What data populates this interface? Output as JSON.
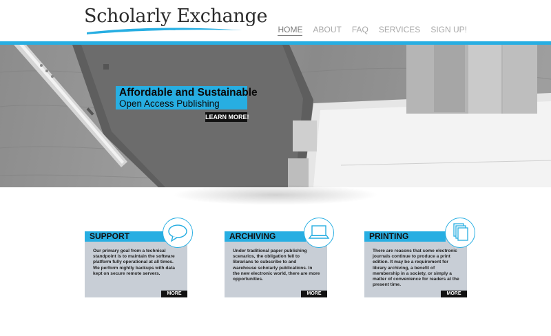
{
  "brand": {
    "name": "Scholarly Exchange",
    "accent": "#27aee2"
  },
  "nav": {
    "items": [
      {
        "label": "HOME",
        "active": true
      },
      {
        "label": "ABOUT",
        "active": false
      },
      {
        "label": "FAQ",
        "active": false
      },
      {
        "label": "SERVICES",
        "active": false
      },
      {
        "label": "SIGN UP!",
        "active": false
      }
    ]
  },
  "hero": {
    "title": "Affordable and Sustainable",
    "subtitle": "Open Access Publishing",
    "cta_label": "LEARN MORE!"
  },
  "cards": [
    {
      "title": "SUPPORT",
      "icon": "speech-bubble-icon",
      "text": "Our primary goal from a technical standpoint is to maintain the software platform fully operational at all times. We perform nightly backups with data kept on secure remote servers.",
      "more_label": "MORE"
    },
    {
      "title": "ARCHIVING",
      "icon": "laptop-icon",
      "text": "Under traditional paper publishing scenarios, the obligation fell to librarians to subscribe to and warehouse scholarly publications. In the new electronic world, there are more opportunities.",
      "more_label": "MORE"
    },
    {
      "title": "PRINTING",
      "icon": "documents-icon",
      "text": "There are reasons that some electronic journals continue to produce a print edition. It may be a requirement for library archiving, a benefit of membership in a society, or simply a matter of convenience for readers at the present time.",
      "more_label": "MORE"
    }
  ]
}
